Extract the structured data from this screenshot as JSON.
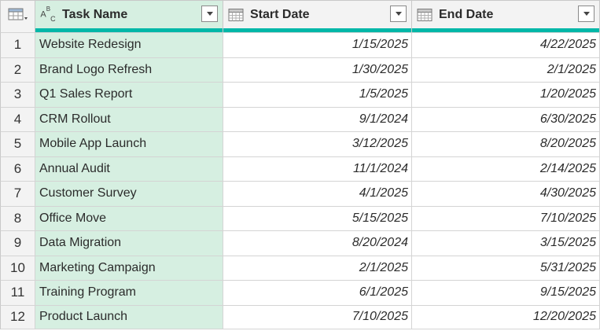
{
  "columns": [
    {
      "name": "Task Name",
      "type_icon": "text-type-icon"
    },
    {
      "name": "Start Date",
      "type_icon": "date-type-icon"
    },
    {
      "name": "End Date",
      "type_icon": "date-type-icon"
    }
  ],
  "rows": [
    {
      "num": "1",
      "task": "Website Redesign",
      "start": "1/15/2025",
      "end": "4/22/2025"
    },
    {
      "num": "2",
      "task": "Brand Logo Refresh",
      "start": "1/30/2025",
      "end": "2/1/2025"
    },
    {
      "num": "3",
      "task": "Q1 Sales Report",
      "start": "1/5/2025",
      "end": "1/20/2025"
    },
    {
      "num": "4",
      "task": "CRM Rollout",
      "start": "9/1/2024",
      "end": "6/30/2025"
    },
    {
      "num": "5",
      "task": "Mobile App Launch",
      "start": "3/12/2025",
      "end": "8/20/2025"
    },
    {
      "num": "6",
      "task": "Annual Audit",
      "start": "11/1/2024",
      "end": "2/14/2025"
    },
    {
      "num": "7",
      "task": "Customer Survey",
      "start": "4/1/2025",
      "end": "4/30/2025"
    },
    {
      "num": "8",
      "task": "Office Move",
      "start": "5/15/2025",
      "end": "7/10/2025"
    },
    {
      "num": "9",
      "task": "Data Migration",
      "start": "8/20/2024",
      "end": "3/15/2025"
    },
    {
      "num": "10",
      "task": "Marketing Campaign",
      "start": "2/1/2025",
      "end": "5/31/2025"
    },
    {
      "num": "11",
      "task": "Training Program",
      "start": "6/1/2025",
      "end": "9/15/2025"
    },
    {
      "num": "12",
      "task": "Product Launch",
      "start": "7/10/2025",
      "end": "12/20/2025"
    }
  ],
  "colors": {
    "selected_column": "#d6efe1",
    "quality_bar": "#00b7a8",
    "header_bg": "#f3f3f3"
  }
}
